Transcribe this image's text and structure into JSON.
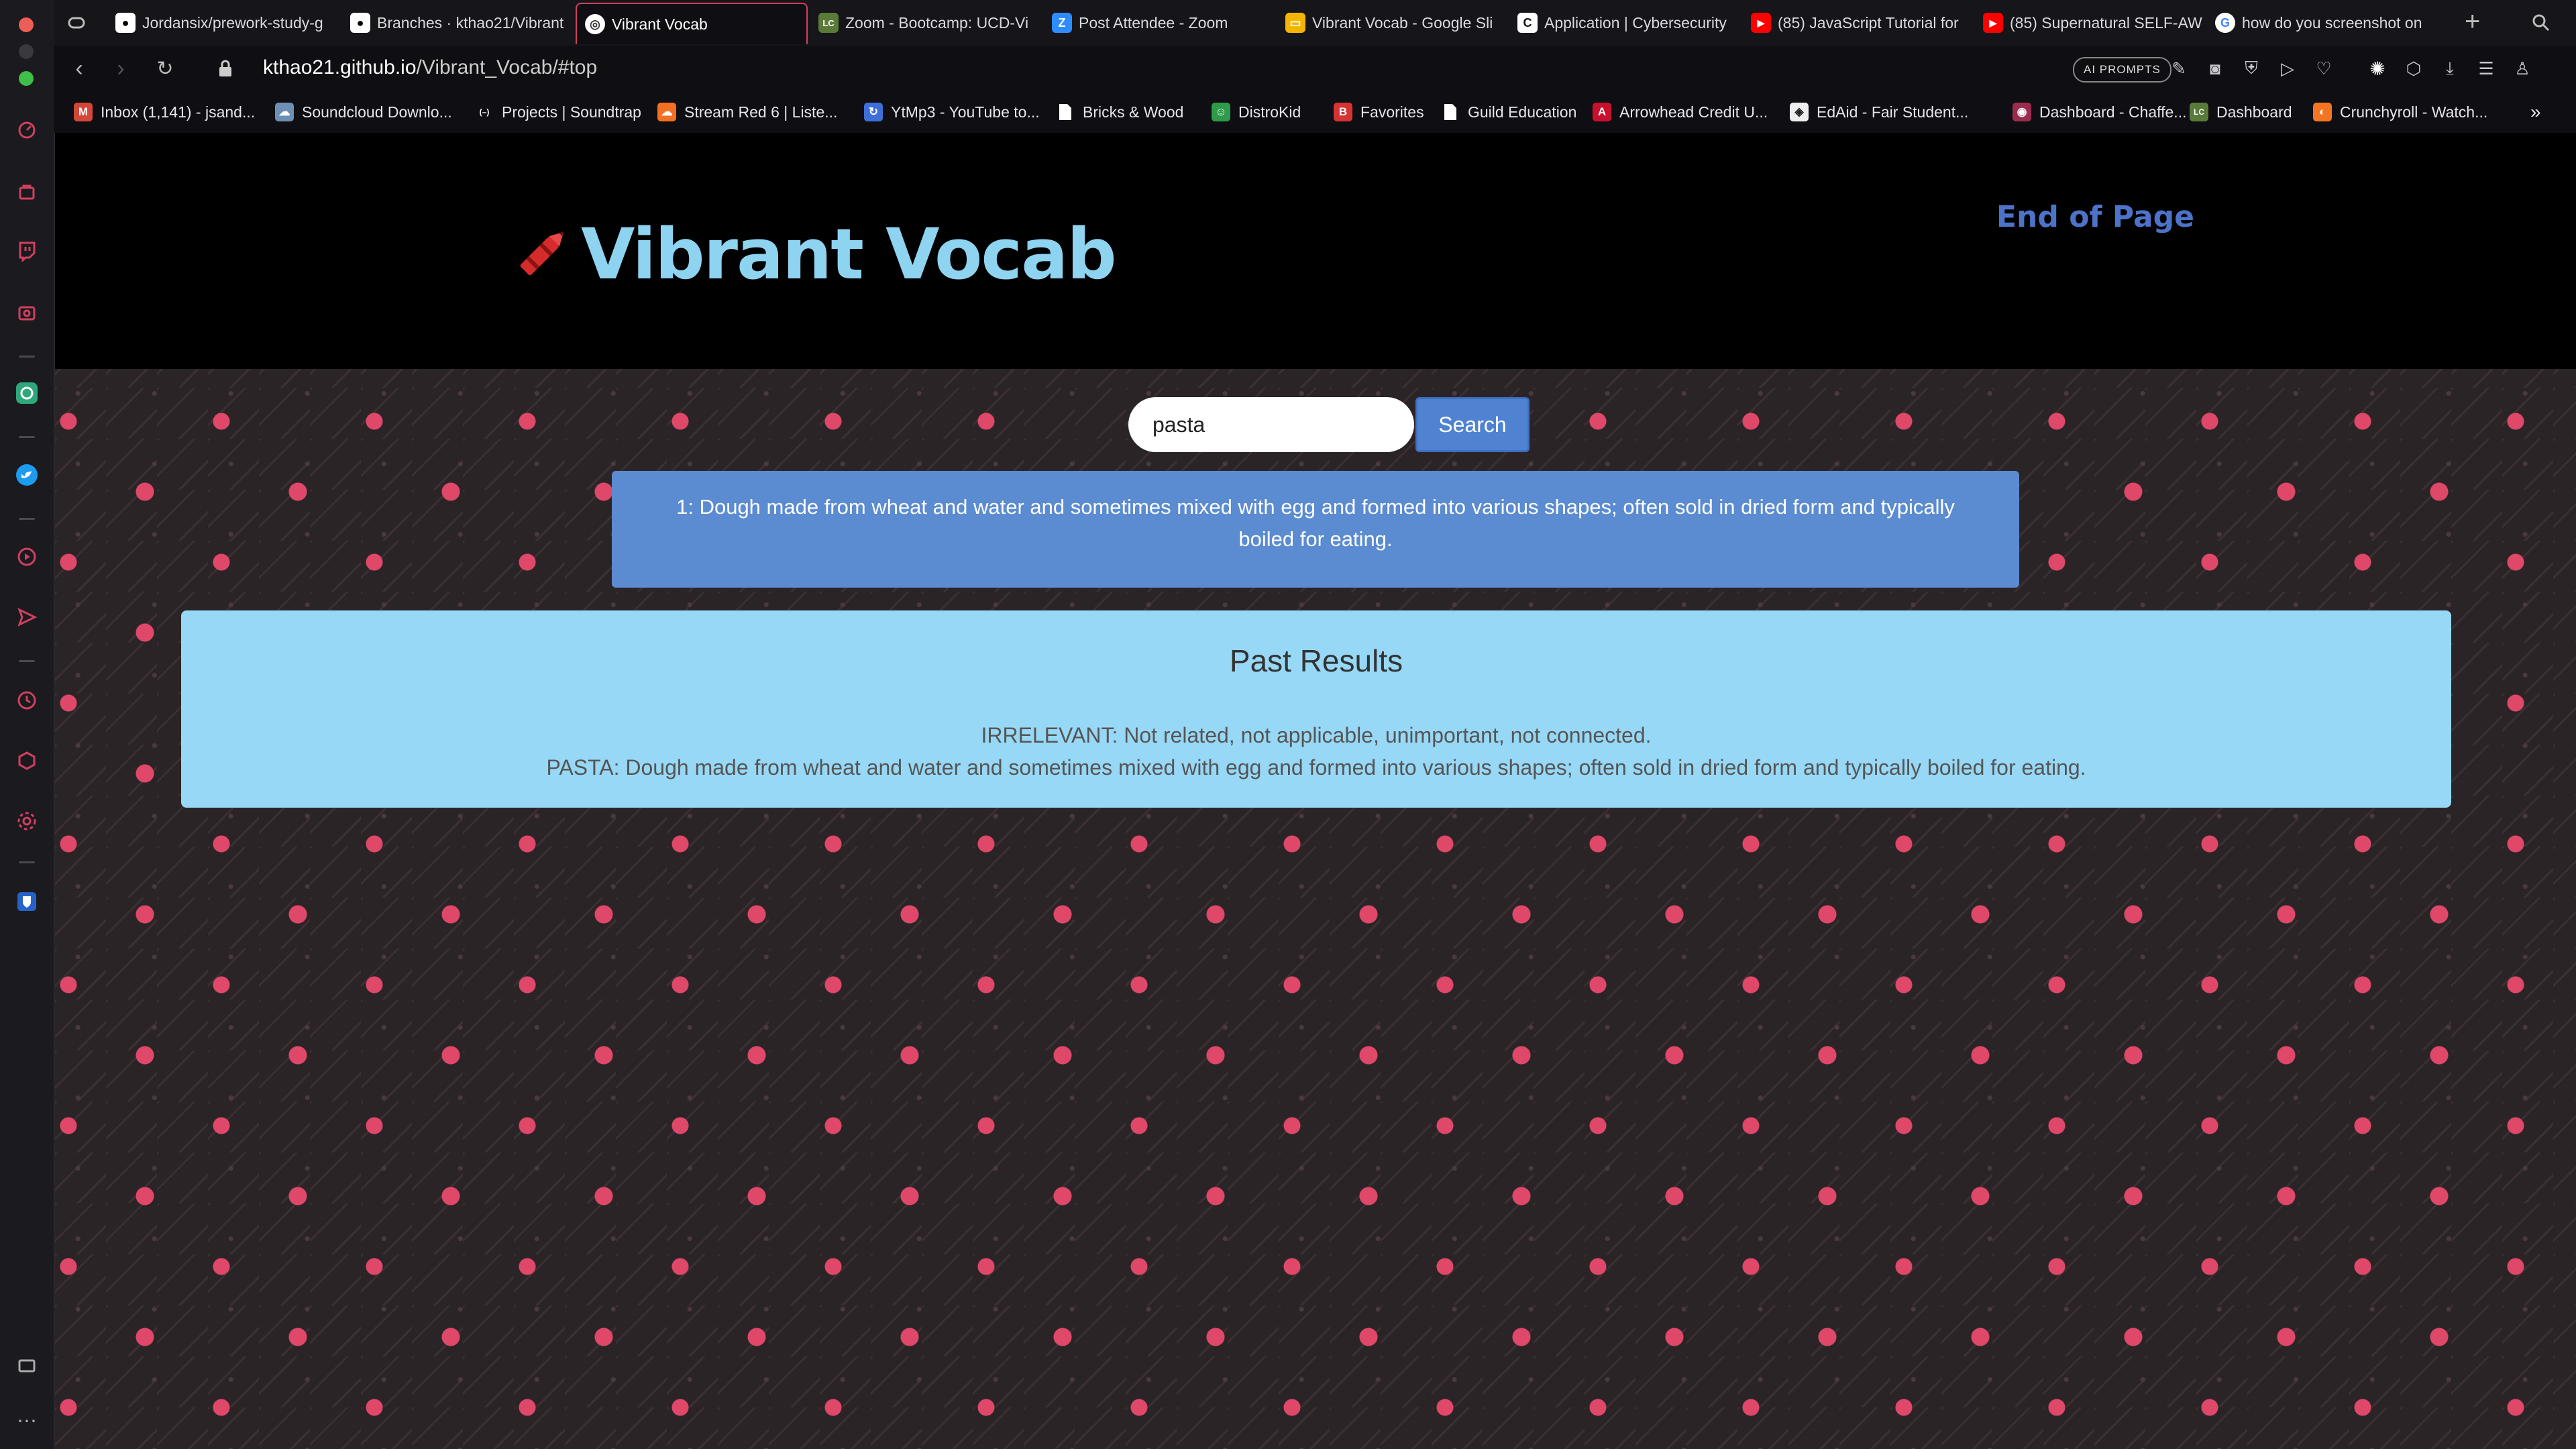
{
  "browser": {
    "tabs": [
      {
        "title": "Jordansix/prework-study-g",
        "icon": "github-icon"
      },
      {
        "title": "Branches · kthao21/Vibrant",
        "icon": "github-icon"
      },
      {
        "title": "Vibrant Vocab",
        "icon": "globe-icon",
        "active": true
      },
      {
        "title": "Zoom - Bootcamp: UCD-Vi",
        "icon": "bootcamp-icon"
      },
      {
        "title": "Post Attendee - Zoom",
        "icon": "zoom-icon"
      },
      {
        "title": "Vibrant Vocab - Google Sli",
        "icon": "slides-icon"
      },
      {
        "title": "Application | Cybersecurity",
        "icon": "c-icon"
      },
      {
        "title": "(85) JavaScript Tutorial for",
        "icon": "youtube-icon"
      },
      {
        "title": "(85) Supernatural SELF-AW",
        "icon": "youtube-icon"
      },
      {
        "title": "how do you screenshot on",
        "icon": "google-icon"
      }
    ],
    "new_tab": "+",
    "url": {
      "domain": "kthao21.github.io",
      "path": "/Vibrant_Vocab/#top"
    },
    "ai_prompts_label": "AI PROMPTS",
    "bookmarks": [
      {
        "label": "Inbox (1,141) - jsand...",
        "icon": "gmail-icon",
        "color": "#d44638",
        "glyph": "M"
      },
      {
        "label": "Soundcloud Downlo...",
        "icon": "cloud-icon",
        "color": "#6d8fb3",
        "glyph": "☁"
      },
      {
        "label": "Projects | Soundtrap",
        "icon": "soundtrap-icon",
        "color": "#0f0e12",
        "glyph": "(–)"
      },
      {
        "label": "Stream Red 6 | Liste...",
        "icon": "soundcloud-icon",
        "color": "#f26f23",
        "glyph": "☁"
      },
      {
        "label": "YtMp3 - YouTube to...",
        "icon": "ytmp3-icon",
        "color": "#3e6fd8",
        "glyph": "↻"
      },
      {
        "label": "Bricks & Wood",
        "icon": "page-icon",
        "color": "#ffffff",
        "glyph": ""
      },
      {
        "label": "DistroKid",
        "icon": "distrokid-icon",
        "color": "#2e9b4a",
        "glyph": "☺"
      },
      {
        "label": "Favorites",
        "icon": "b-icon",
        "color": "#d63333",
        "glyph": "B"
      },
      {
        "label": "Guild Education",
        "icon": "page-icon",
        "color": "#ffffff",
        "glyph": ""
      },
      {
        "label": "Arrowhead Credit U...",
        "icon": "arrowhead-icon",
        "color": "#c8102e",
        "glyph": "A"
      },
      {
        "label": "EdAid - Fair Student...",
        "icon": "edaid-icon",
        "color": "#eeeeee",
        "glyph": "◈"
      },
      {
        "label": "Dashboard - Chaffe...",
        "icon": "chaffey-icon",
        "color": "#9b2c4e",
        "glyph": "◉"
      },
      {
        "label": "Dashboard",
        "icon": "lc-icon",
        "color": "#5a7a3a",
        "glyph": "LC"
      },
      {
        "label": "Crunchyroll - Watch...",
        "icon": "crunchyroll-icon",
        "color": "#f47521",
        "glyph": "◐"
      }
    ],
    "more_bookmarks": "»"
  },
  "site": {
    "title": "Vibrant Vocab",
    "end_link": "End of Page"
  },
  "search": {
    "value": "pasta",
    "button_label": "Search"
  },
  "definition": "1: Dough made from wheat and water and sometimes mixed with egg and formed into various shapes; often sold in dried form and typically boiled for eating.",
  "past_results": {
    "title": "Past Results",
    "items": [
      "IRRELEVANT: Not related, not applicable, unimportant, not connected.",
      "PASTA: Dough made from wheat and water and sometimes mixed with egg and formed into various shapes; often sold in dried form and typically boiled for eating."
    ]
  },
  "colors": {
    "title": "#8ed3f0",
    "end_link": "#4d73c9",
    "definition_bg": "#5b8bd0",
    "past_bg": "#97d8f6",
    "flower": "#e0486a"
  }
}
